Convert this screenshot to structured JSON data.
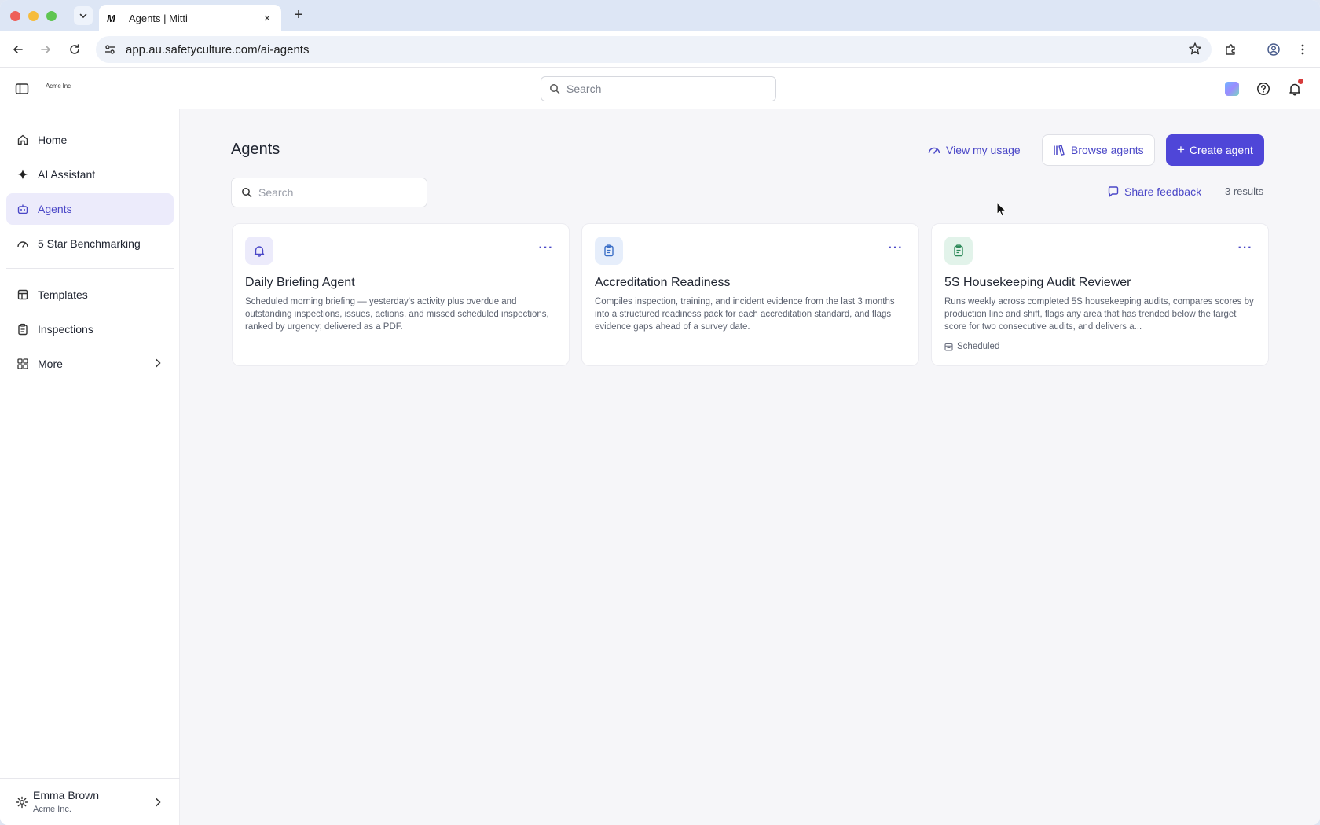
{
  "browser": {
    "tab_favicon": "M",
    "tab_title": "Agents | Mitti",
    "tab_close": "×",
    "new_tab": "+",
    "url": "app.au.safetyculture.com/ai-agents"
  },
  "topbar": {
    "org_logo_text": "Acme Inc",
    "search_placeholder": "Search"
  },
  "sidebar": {
    "items": [
      {
        "label": "Home",
        "icon": "home-icon"
      },
      {
        "label": "AI Assistant",
        "icon": "sparkle-icon"
      },
      {
        "label": "Agents",
        "icon": "robot-icon",
        "active": true
      },
      {
        "label": "5 Star Benchmarking",
        "icon": "gauge-icon"
      },
      {
        "label": "Templates",
        "icon": "template-icon"
      },
      {
        "label": "Inspections",
        "icon": "clipboard-icon"
      },
      {
        "label": "More",
        "icon": "grid-icon"
      }
    ],
    "user": {
      "name": "Emma Brown",
      "org": "Acme Inc."
    }
  },
  "main": {
    "title": "Agents",
    "view_usage": "View my usage",
    "browse_agents": "Browse agents",
    "create_agent": "Create agent",
    "search_placeholder": "Search",
    "share_feedback": "Share feedback",
    "results": "3 results",
    "cards": [
      {
        "title": "Daily Briefing Agent",
        "description": "Scheduled morning briefing — yesterday's activity plus overdue and outstanding inspections, issues, actions, and missed scheduled inspections, ranked by urgency; delivered as a PDF.",
        "icon": "bell-icon",
        "icon_bg": "#ecebfb",
        "icon_color": "#4a47c7"
      },
      {
        "title": "Accreditation Readiness",
        "description": "Compiles inspection, training, and incident evidence from the last 3 months into a structured readiness pack for each accreditation standard, and flags evidence gaps ahead of a survey date.",
        "icon": "clipboard-icon",
        "icon_bg": "#e6eefb",
        "icon_color": "#3b6fc7"
      },
      {
        "title": "5S Housekeeping Audit Reviewer",
        "description": "Runs weekly across completed 5S housekeeping audits, compares scores by production line and shift, flags any area that has trended below the target score for two consecutive audits, and delivers a...",
        "icon": "clipboard-icon",
        "icon_bg": "#e2f3ea",
        "icon_color": "#2f8a5a",
        "badge": "Scheduled"
      }
    ]
  },
  "colors": {
    "accent": "#4f46d8",
    "accent_text": "#4a47c7"
  }
}
